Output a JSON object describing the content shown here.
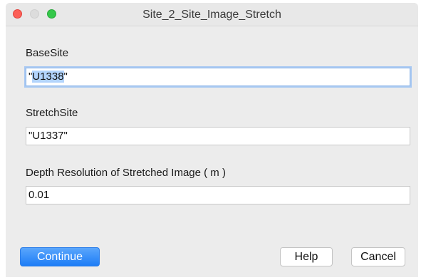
{
  "window": {
    "title": "Site_2_Site_Image_Stretch"
  },
  "fields": {
    "base_site": {
      "label": "BaseSite",
      "value_prefix": "\"",
      "value_selected": "U1338",
      "value_suffix": "\""
    },
    "stretch_site": {
      "label": "StretchSite",
      "value": "\"U1337\""
    },
    "depth_resolution": {
      "label": "Depth Resolution of Stretched Image ( m )",
      "value": "0.01"
    }
  },
  "buttons": {
    "continue_label": "Continue",
    "help_label": "Help",
    "cancel_label": "Cancel"
  },
  "colors": {
    "accent": "#1d7df6",
    "close": "#fc5f57",
    "zoom": "#34c84a"
  }
}
